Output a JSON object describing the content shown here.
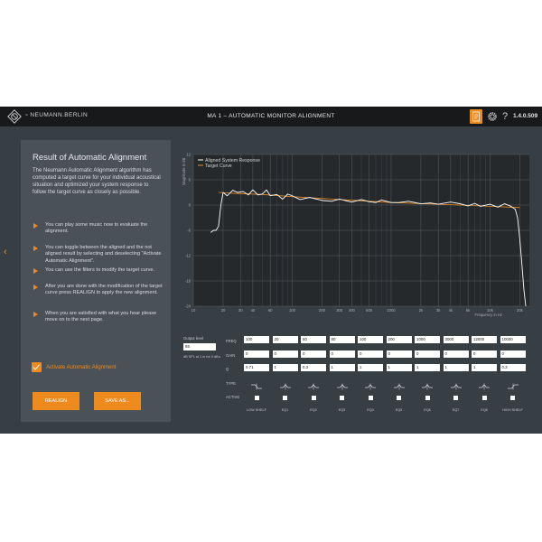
{
  "header": {
    "logo_small": "™",
    "logo_text": "NEUMANN.BERLIN",
    "title": "MA 1 – AUTOMATIC MONITOR ALIGNMENT",
    "help": "?",
    "version": "1.4.0.509",
    "icons": [
      "document-icon",
      "gear-icon",
      "help-icon"
    ],
    "accent": "#ef8a1e"
  },
  "nav": {
    "back_glyph": "‹"
  },
  "panel": {
    "title": "Result of Automatic Alignment",
    "intro": "The Neumann Automatic Alignment algorithm has computed a target curve for your individual acoustical situation and optimized your system response to follow the target curve as closely as possible.",
    "steps": [
      "You can play some music now to evaluate the alignment.",
      "You can toggle between the aligned and the not aligned result by selecting and deselecting \"Activate Automatic Alignment\".",
      "You can use the filters to modify the target curve.",
      "After you are done with the modification of the target curve press REALIGN to apply the new alignment.",
      "When you are satisfied with what you hear please move on to the next page."
    ],
    "activate_label": "Activate Automatic Alignment",
    "activate_checked": true,
    "realign_label": "REALIGN",
    "save_label": "SAVE AS..."
  },
  "chart_data": {
    "type": "line",
    "xscale": "log",
    "xlim": [
      10,
      25000
    ],
    "ylim": [
      -24,
      12
    ],
    "ylabel": "Magnitude in dB",
    "xlabel": "Frequency in Hz",
    "x_ticks": [
      "10",
      "20",
      "30",
      "40",
      "60",
      "100",
      "200",
      "300",
      "400",
      "600",
      "1000",
      "2k",
      "3k",
      "4k",
      "6k",
      "10k",
      "20k"
    ],
    "y_ticks": [
      "12",
      "6",
      "0",
      "-6",
      "-12",
      "-18",
      "-24"
    ],
    "grid": true,
    "legend_position": "top-left",
    "series": [
      {
        "name": "Aligned System Response",
        "color": "#ffffff",
        "x": [
          15,
          16,
          17,
          18,
          19,
          20,
          22,
          25,
          28,
          32,
          36,
          40,
          45,
          50,
          55,
          60,
          70,
          80,
          90,
          100,
          120,
          150,
          200,
          250,
          300,
          400,
          500,
          600,
          700,
          800,
          1000,
          1200,
          1500,
          2000,
          2500,
          3000,
          4000,
          5000,
          6000,
          7000,
          8000,
          10000,
          12000,
          14000,
          16000,
          18000,
          19000,
          20000,
          21000,
          22000,
          23000
        ],
        "values": [
          -6.5,
          -6,
          -6,
          -5,
          0,
          3,
          2.2,
          3.5,
          3,
          3.2,
          2.4,
          3.6,
          2.4,
          2.6,
          3.6,
          2.2,
          2.5,
          1.4,
          2.6,
          2.2,
          1.3,
          1.8,
          1.1,
          0.9,
          1.4,
          0.7,
          1.3,
          0.8,
          0.6,
          1.2,
          0.6,
          0.6,
          0.9,
          0.3,
          0.5,
          0.2,
          0.7,
          0.3,
          -0.2,
          0.4,
          -0.3,
          0.2,
          -0.5,
          0.3,
          -0.2,
          -1,
          -3,
          -8,
          -14,
          -20,
          -24
        ]
      },
      {
        "name": "Target Curve",
        "color": "#ef8a1e",
        "x": [
          18,
          25,
          50,
          100,
          500,
          1000,
          5000,
          10000,
          20000
        ],
        "values": [
          3,
          2.8,
          2.5,
          2,
          1,
          0.6,
          0,
          -0.3,
          -0.6
        ]
      }
    ]
  },
  "eq": {
    "output_level_label": "Output level",
    "output_level_value": "85",
    "output_level_note": "dB SPL at 1 m for 0 dBu",
    "row_labels": {
      "freq": "FREQ",
      "gain": "GAIN",
      "q": "Q",
      "type": "TYPE",
      "active": "ACTIVE"
    },
    "bands": [
      {
        "name": "LOW SHELF",
        "freq": "100",
        "gain": "0",
        "q": "0.71",
        "type_icon": "low-shelf-icon",
        "active": false
      },
      {
        "name": "EQ1",
        "freq": "20",
        "gain": "0",
        "q": "1",
        "type_icon": "peak-filter-icon",
        "active": false
      },
      {
        "name": "EQ2",
        "freq": "50",
        "gain": "0",
        "q": "0.3",
        "type_icon": "peak-filter-icon",
        "active": false
      },
      {
        "name": "EQ3",
        "freq": "80",
        "gain": "0",
        "q": "1",
        "type_icon": "peak-filter-icon",
        "active": false
      },
      {
        "name": "EQ4",
        "freq": "100",
        "gain": "0",
        "q": "1",
        "type_icon": "peak-filter-icon",
        "active": false
      },
      {
        "name": "EQ5",
        "freq": "200",
        "gain": "0",
        "q": "1",
        "type_icon": "peak-filter-icon",
        "active": false
      },
      {
        "name": "EQ6",
        "freq": "1000",
        "gain": "0",
        "q": "1",
        "type_icon": "peak-filter-icon",
        "active": false
      },
      {
        "name": "EQ7",
        "freq": "3000",
        "gain": "0",
        "q": "1",
        "type_icon": "peak-filter-icon",
        "active": false
      },
      {
        "name": "EQ8",
        "freq": "12000",
        "gain": "0",
        "q": "1",
        "type_icon": "peak-filter-icon",
        "active": false
      },
      {
        "name": "HIGH SHELF",
        "freq": "10000",
        "gain": "0",
        "q": "0.3",
        "type_icon": "high-shelf-icon",
        "active": false
      }
    ]
  }
}
